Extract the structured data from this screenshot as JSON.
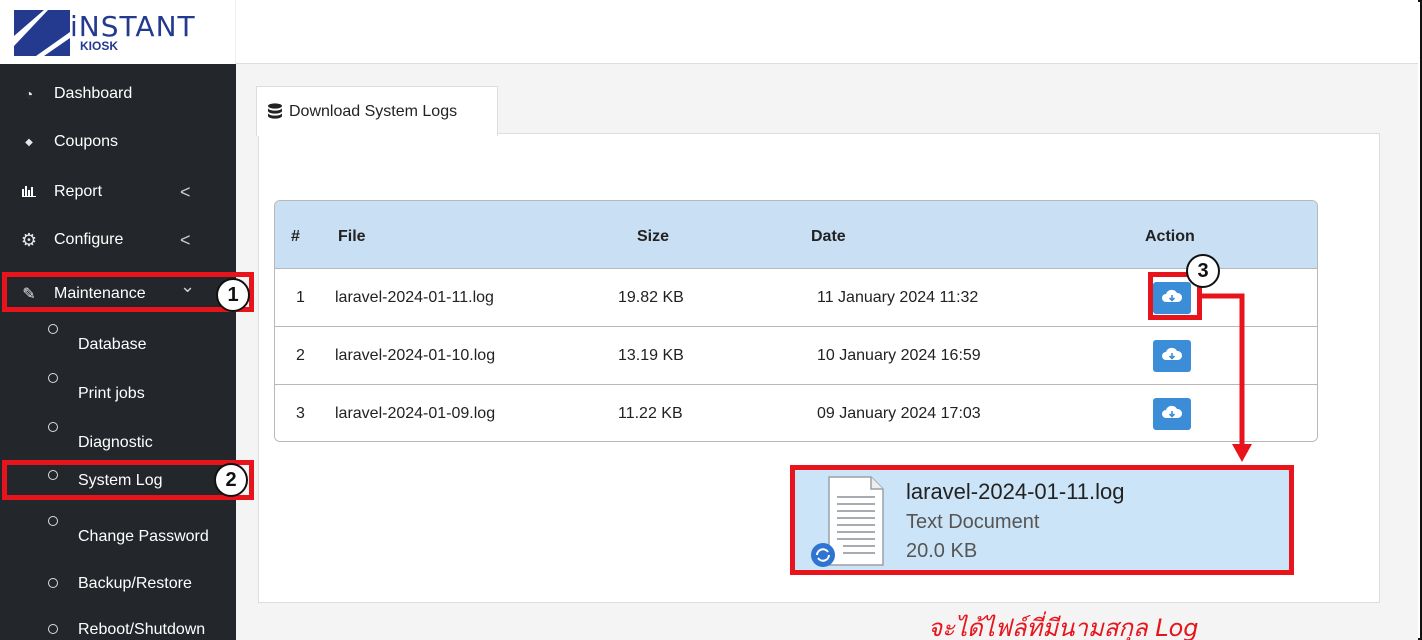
{
  "brand": {
    "line1": "iNSTANT",
    "line2": "KIOSK"
  },
  "sidebar": {
    "items": [
      {
        "label": "Dashboard",
        "icon": "gauge-icon",
        "glyph": "◔"
      },
      {
        "label": "Coupons",
        "icon": "tag-icon",
        "glyph": "◆"
      },
      {
        "label": "Report",
        "icon": "bar-chart-icon",
        "glyph": "▮",
        "caret": "<"
      },
      {
        "label": "Configure",
        "icon": "gear-icon",
        "glyph": "⚙",
        "caret": "<"
      },
      {
        "label": "Maintenance",
        "icon": "wrench-icon",
        "glyph": "✎",
        "caret": "⌄"
      }
    ],
    "subitems": [
      "Database",
      "Print jobs",
      "Diagnostic",
      "System Log",
      "Change Password",
      "Backup/Restore",
      "Reboot/Shutdown"
    ]
  },
  "tab": {
    "label": "Download System Logs",
    "icon": "database-icon"
  },
  "table": {
    "headers": [
      "#",
      "File",
      "Size",
      "Date",
      "Action"
    ],
    "rows": [
      {
        "num": "1",
        "file": "laravel-2024-01-11.log",
        "size": "19.82 KB",
        "date": "11 January 2024 11:32"
      },
      {
        "num": "2",
        "file": "laravel-2024-01-10.log",
        "size": "13.19 KB",
        "date": "10 January 2024 16:59"
      },
      {
        "num": "3",
        "file": "laravel-2024-01-09.log",
        "size": "11.22 KB",
        "date": "09 January 2024 17:03"
      }
    ]
  },
  "annotations": {
    "step1": "1",
    "step2": "2",
    "step3": "3",
    "color": "#e8141b"
  },
  "file_preview": {
    "name": "laravel-2024-01-11.log",
    "type": "Text Document",
    "size": "20.0 KB"
  },
  "caption": "จะได้ไฟล์ที่มีนามสกุล Log",
  "colors": {
    "sidebar_bg": "#23272b",
    "header_row": "#c9dff3",
    "button": "#3c8dd8",
    "brand": "#233a8f"
  }
}
